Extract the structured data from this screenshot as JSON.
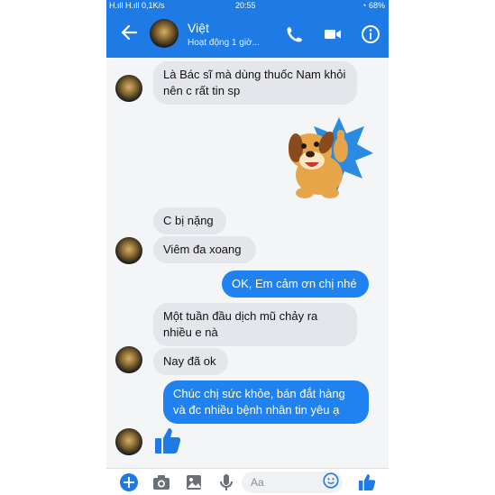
{
  "status_bar": {
    "signal": "H.ıll H.ıll",
    "speed": "0,1K/s",
    "time": "20:55",
    "battery": "68%"
  },
  "header": {
    "name": "Việt",
    "status": "Hoạt động 1 giờ..."
  },
  "messages": [
    {
      "side": "in",
      "text": "Là Bác sĩ mà dùng thuốc Nam khỏi nên c rất tin sp"
    },
    {
      "side": "in",
      "sticker": "thumbs-up-dog-sticker"
    },
    {
      "side": "in",
      "text": "C bị nặng"
    },
    {
      "side": "in",
      "text": "Viêm đa xoang"
    },
    {
      "side": "out",
      "text": "OK, Em cảm ơn chị nhé"
    },
    {
      "side": "in",
      "text": "Một tuần đầu dịch mũ chảy ra nhiều e nà"
    },
    {
      "side": "in",
      "text": "Nay đã ok"
    },
    {
      "side": "out",
      "text": "Chúc chị sức khỏe, bán đắt hàng và đc nhiều bệnh nhân tin yêu ạ"
    },
    {
      "side": "in",
      "sticker": "like-icon"
    }
  ],
  "composer": {
    "placeholder": "Aa"
  },
  "colors": {
    "accent": "#1e7be6",
    "outgoing": "#1f82f0",
    "incoming": "#e4e6eb"
  }
}
